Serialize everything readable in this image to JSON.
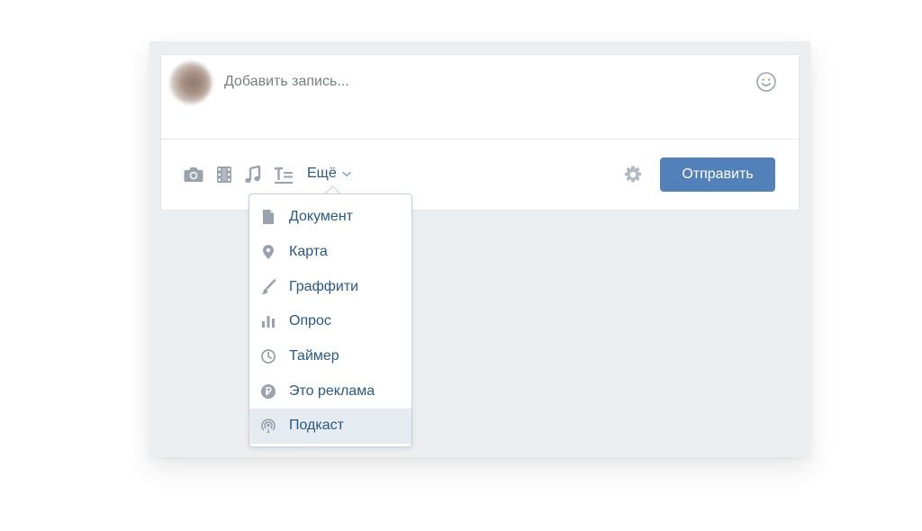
{
  "composer": {
    "placeholder": "Добавить запись...",
    "more_label": "Ещё",
    "send_label": "Отправить"
  },
  "toolbar_icons": [
    "camera-icon",
    "video-icon",
    "music-icon",
    "article-icon"
  ],
  "dropdown": {
    "items": [
      {
        "label": "Документ",
        "icon": "document-icon",
        "active": false
      },
      {
        "label": "Карта",
        "icon": "map-pin-icon",
        "active": false
      },
      {
        "label": "Граффити",
        "icon": "brush-icon",
        "active": false
      },
      {
        "label": "Опрос",
        "icon": "poll-icon",
        "active": false
      },
      {
        "label": "Таймер",
        "icon": "clock-icon",
        "active": false
      },
      {
        "label": "Это реклама",
        "icon": "ruble-icon",
        "active": false
      },
      {
        "label": "Подкаст",
        "icon": "podcast-icon",
        "active": true
      }
    ]
  },
  "colors": {
    "accent": "#5181b8",
    "link": "#2a5885",
    "icon": "#99a2ad",
    "page_bg": "#edeef0"
  }
}
